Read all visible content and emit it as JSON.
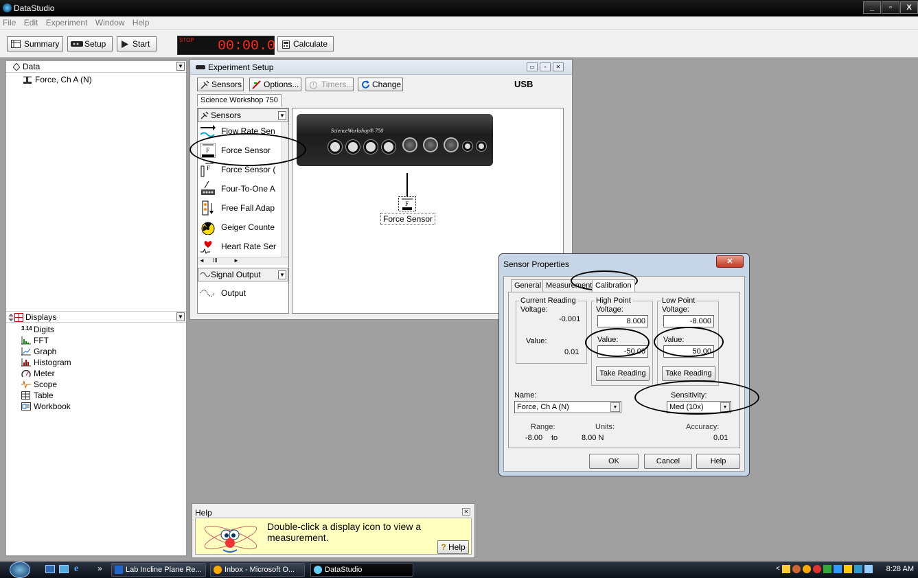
{
  "window": {
    "title": "DataStudio",
    "buttons": [
      "_",
      "▫",
      "X"
    ]
  },
  "menu": [
    "File",
    "Edit",
    "Experiment",
    "Window",
    "Help"
  ],
  "toolbar": {
    "summary": "Summary",
    "setup": "Setup",
    "start": "Start",
    "stop": "STOP",
    "time": "00:00.0",
    "calculate": "Calculate"
  },
  "data_pane": {
    "header": "Data",
    "items": [
      "Force, Ch A (N)"
    ]
  },
  "displays_pane": {
    "header": "Displays",
    "items": [
      "Digits",
      "FFT",
      "Graph",
      "Histogram",
      "Meter",
      "Scope",
      "Table",
      "Workbook"
    ],
    "digits_icon_text": "3.14"
  },
  "experiment_setup": {
    "title": "Experiment Setup",
    "sensors_btn": "Sensors",
    "options_btn": "Options...",
    "timers_btn": "Timers...",
    "change_btn": "Change",
    "usb": "USB",
    "interface_tab": "Science Workshop 750",
    "sensors_header": "Sensors",
    "sensors": [
      "Flow Rate Sen",
      "Force Sensor",
      "Force Sensor (",
      "Four-To-One A",
      "Free Fall Adap",
      "Geiger Counte",
      "Heart Rate Ser"
    ],
    "signal_header": "Signal Output",
    "signal_items": [
      "Output"
    ],
    "interface_brand": "ScienceWorkshop® 750",
    "connected_sensor": "Force Sensor"
  },
  "sensor_properties": {
    "title": "Sensor Properties",
    "tabs": [
      "General",
      "Measurement",
      "Calibration"
    ],
    "current": {
      "label": "Current Reading",
      "voltage_label": "Voltage:",
      "voltage": "-0.001",
      "value_label": "Value:",
      "value": "0.01"
    },
    "high": {
      "label": "High Point",
      "voltage_label": "Voltage:",
      "voltage": "8.000",
      "value_label": "Value:",
      "value": "-50.00",
      "take": "Take Reading"
    },
    "low": {
      "label": "Low Point",
      "voltage_label": "Voltage:",
      "voltage": "-8.000",
      "value_label": "Value:",
      "value": "50.00",
      "take": "Take Reading"
    },
    "name_label": "Name:",
    "name_value": "Force, Ch A (N)",
    "sensitivity_label": "Sensitivity:",
    "sensitivity_value": "Med (10x)",
    "range_label": "Range:",
    "range_low": "-8.00",
    "range_to": "to",
    "range_high": "8.00 N",
    "units_label": "Units:",
    "accuracy_label": "Accuracy:",
    "accuracy_value": "0.01",
    "ok": "OK",
    "cancel": "Cancel",
    "help": "Help"
  },
  "help_panel": {
    "title": "Help",
    "message": "Double-click a display icon to view a measurement.",
    "button": "Help"
  },
  "taskbar": {
    "tasks": [
      "Lab Incline Plane Re...",
      "Inbox - Microsoft O...",
      "DataStudio"
    ],
    "clock": "8:28 AM"
  },
  "colors": {
    "timer_red": "#ff2a1a",
    "title_bar": "#000000",
    "help_bg": "#ffffc0"
  }
}
